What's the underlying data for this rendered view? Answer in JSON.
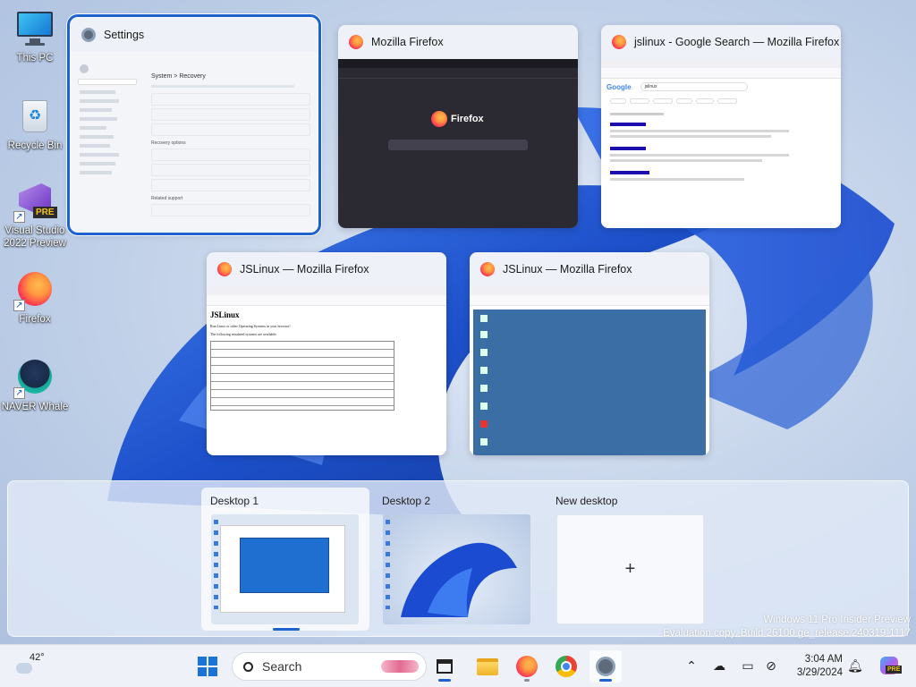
{
  "desktop_icons": [
    {
      "label": "This PC",
      "icon": "monitor-icon"
    },
    {
      "label": "Recycle Bin",
      "icon": "recycle-bin-icon"
    },
    {
      "label": "Visual Studio 2022 Preview",
      "icon": "visual-studio-icon",
      "badge": "PRE"
    },
    {
      "label": "Firefox",
      "icon": "firefox-icon"
    },
    {
      "label": "NAVER Whale",
      "icon": "whale-icon"
    }
  ],
  "windows": [
    {
      "title": "Settings",
      "icon": "settings-gear-icon",
      "selected": true,
      "content": {
        "breadcrumb": "System  >  Recovery",
        "section1": "Recovery options",
        "section2": "Related support"
      }
    },
    {
      "title": "Mozilla Firefox",
      "icon": "firefox-icon",
      "content": {
        "logo_text": "Firefox"
      }
    },
    {
      "title": "jslinux - Google Search — Mozilla Firefox",
      "icon": "firefox-icon",
      "content": {
        "logo_text": "Google",
        "query": "jslinux"
      }
    },
    {
      "title": "JSLinux — Mozilla Firefox",
      "icon": "firefox-icon",
      "content": {
        "heading": "JSLinux",
        "line1": "Run Linux or other Operating Systems in your browser!",
        "line2": "The following emulated systems are available:"
      }
    },
    {
      "title": "JSLinux — Mozilla Firefox",
      "icon": "firefox-icon",
      "content": {}
    }
  ],
  "virtual_desktops": [
    {
      "label": "Desktop 1",
      "active": true
    },
    {
      "label": "Desktop 2",
      "active": false
    },
    {
      "label": "New desktop",
      "symbol": "+"
    }
  ],
  "watermark": {
    "line1": "Windows 11 Pro Insider Preview",
    "line2": "Evaluation copy. Build 26100.ge_release.240319-1117"
  },
  "taskbar": {
    "weather_temp": "42°",
    "search_placeholder": "Search",
    "clock_time": "3:04 AM",
    "clock_date": "3/29/2024",
    "apps": [
      "start-button",
      "search",
      "task-view-button",
      "file-explorer-icon",
      "firefox-icon",
      "chrome-icon",
      "settings-icon"
    ],
    "tray": [
      "chevron-up-icon",
      "cloud-offline-icon",
      "display-icon",
      "network-disconnected-icon",
      "notification-bell-icon",
      "copilot-icon"
    ],
    "copilot_badge": "PRE"
  },
  "colors": {
    "accent": "#1e62d0",
    "taskbar_bg": "#eef1f7",
    "dark_window": "#2b2a33"
  }
}
